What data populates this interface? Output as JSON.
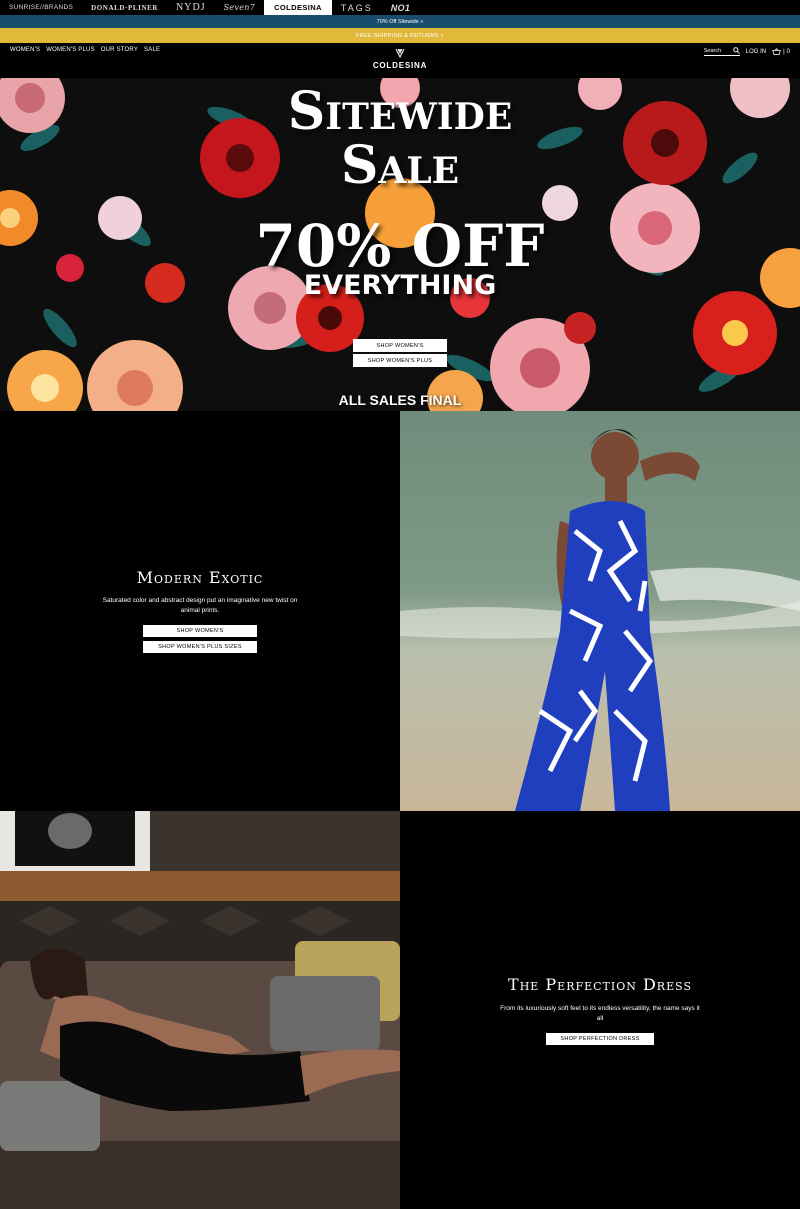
{
  "brands": [
    "SUNRISE//BRANDS",
    "DONALD·PLINER",
    "NYDJ",
    "Seven7",
    "COLDESINA",
    "TAGS",
    "NO1"
  ],
  "promos": {
    "top": "70% Off Sitewide »",
    "shipping": "FREE SHIPPING & RETURNS »"
  },
  "header": {
    "nav": [
      "WOMEN'S",
      "WOMEN'S PLUS",
      "OUR STORY",
      "SALE"
    ],
    "logo": "COLDESINA",
    "search_label": "Search",
    "login": "LOG IN",
    "cart_count": "0"
  },
  "hero": {
    "line1": "Sitewide",
    "line2": "Sale",
    "line3": "70% OFF",
    "line4": "EVERYTHING",
    "button1": "SHOP WOMEN'S",
    "button2": "SHOP WOMEN'S PLUS",
    "footer": "ALL SALES FINAL"
  },
  "section1": {
    "title": "Modern Exotic",
    "description": "Saturated color and abstract design put an imaginative new twist on animal prints.",
    "button1": "SHOP WOMEN'S",
    "button2": "SHOP WOMEN'S PLUS SIZES"
  },
  "section2": {
    "title": "The Perfection Dress",
    "description": "From its luxuriously soft feel to its endless versatility, the name says it all",
    "button": "SHOP PERFECTION DRESS"
  },
  "colors": {
    "promo_blue": "#1a4d6b",
    "promo_gold": "#e1b93a",
    "dress_blue": "#1f3fbf"
  }
}
